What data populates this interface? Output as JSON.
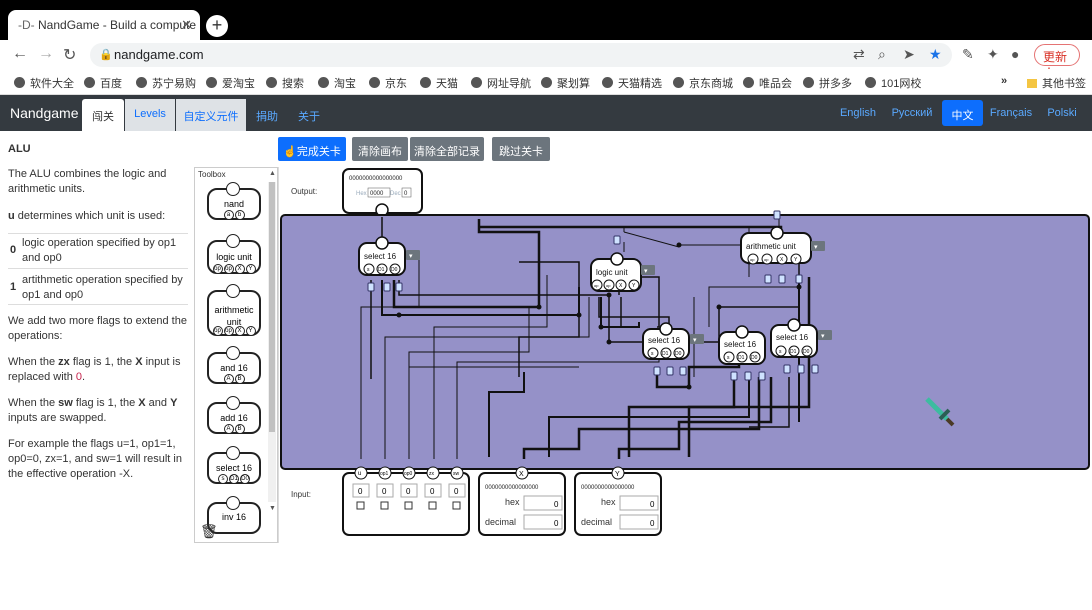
{
  "browser": {
    "tab_title": "NandGame - Build a compute",
    "url": "nandgame.com",
    "update_label": "更新",
    "bookmarks": [
      "软件大全",
      "百度",
      "苏宁易购",
      "爱淘宝",
      "搜索",
      "淘宝",
      "京东",
      "天猫",
      "网址导航",
      "聚划算",
      "天猫精选",
      "京东商城",
      "唯品会",
      "拼多多",
      "101网校"
    ],
    "bookmarks_more": "»",
    "other_bookmarks": "其他书签"
  },
  "nav": {
    "brand": "Nandgame",
    "tabs": [
      "闯关",
      "Levels",
      "自定义元件",
      "捐助",
      "关于"
    ],
    "languages": [
      "English",
      "Русский",
      "中文",
      "Français",
      "Polski"
    ]
  },
  "level": {
    "title": "ALU",
    "intro": "The ALU combines the logic and arithmetic units.",
    "u_text_bold": "u",
    "u_text_rest": " determines which unit is used:",
    "table": [
      {
        "value": "0",
        "desc": "logic operation specified by op1 and op0"
      },
      {
        "value": "1",
        "desc": "artithmetic operation specified by op1 and op0"
      }
    ],
    "flags_intro": "We add two more flags to extend the operations:",
    "zx_pre": "When the ",
    "zx_flag": "zx",
    "zx_mid": " flag is 1, the ",
    "zx_x": "X",
    "zx_post": " input is replaced with ",
    "zx_zero": "0",
    "zx_end": ".",
    "sw_pre": "When the ",
    "sw_flag": "sw",
    "sw_mid": " flag is 1, the ",
    "sw_x": "X",
    "sw_and": " and ",
    "sw_y": "Y",
    "sw_post": " inputs are swapped.",
    "example": "For example the flags u=1, op1=1, op0=0, zx=1, and sw=1 will result in the effective operation -X."
  },
  "actions": {
    "complete": "完成关卡",
    "clear_canvas": "清除画布",
    "clear_all": "清除全部记录",
    "skip": "跳过关卡"
  },
  "toolbox": {
    "title": "Toolbox",
    "items": [
      {
        "label": "nand",
        "pins": [
          "a",
          "b"
        ]
      },
      {
        "label": "logic unit",
        "pins": [
          "op",
          "op",
          "X",
          "Y"
        ]
      },
      {
        "label": "arithmetic unit",
        "pins": [
          "op",
          "op",
          "X",
          "Y"
        ]
      },
      {
        "label": "and 16",
        "pins": [
          "A",
          "B"
        ]
      },
      {
        "label": "add 16",
        "pins": [
          "A",
          "B"
        ]
      },
      {
        "label": "select 16",
        "pins": [
          "s",
          "D1",
          "D0"
        ]
      },
      {
        "label": "inv 16",
        "pins": []
      }
    ]
  },
  "circuit": {
    "output_label": "Output:",
    "input_label": "Input:",
    "output_bits": "0000000000000000",
    "output_hex_label": "Hex",
    "output_hex_value": "0000",
    "output_dec_label": "Dec",
    "output_dec_value": "0",
    "flags": [
      {
        "name": "u",
        "value": "0"
      },
      {
        "name": "op1",
        "value": "0"
      },
      {
        "name": "op0",
        "value": "0"
      },
      {
        "name": "zx",
        "value": "0"
      },
      {
        "name": "sw",
        "value": "0"
      }
    ],
    "x_input": {
      "name": "X",
      "bits": "0000000000000000",
      "hex_label": "hex",
      "hex": "0",
      "dec_label": "decimal",
      "dec": "0"
    },
    "y_input": {
      "name": "Y",
      "bits": "0000000000000000",
      "hex_label": "hex",
      "hex": "0",
      "dec_label": "decimal",
      "dec": "0"
    },
    "components": [
      {
        "label": "select 16",
        "pins": [
          "s",
          "D1",
          "D0"
        ]
      },
      {
        "label": "logic unit",
        "pins": [
          "op",
          "op",
          "X",
          "Y"
        ]
      },
      {
        "label": "arithmetic unit",
        "pins": [
          "op",
          "op",
          "X",
          "Y"
        ]
      },
      {
        "label": "select 16",
        "pins": [
          "s",
          "D1",
          "D0"
        ]
      },
      {
        "label": "select 16",
        "pins": [
          "s",
          "D1",
          "D0"
        ]
      },
      {
        "label": "select 16",
        "pins": [
          "s",
          "D1",
          "D0"
        ]
      }
    ],
    "bus_value": "0"
  },
  "colors": {
    "canvas_purple": "#9591c8",
    "accent_blue": "#0d6efd",
    "secondary_gray": "#6c757d",
    "navbar": "#343a40"
  }
}
